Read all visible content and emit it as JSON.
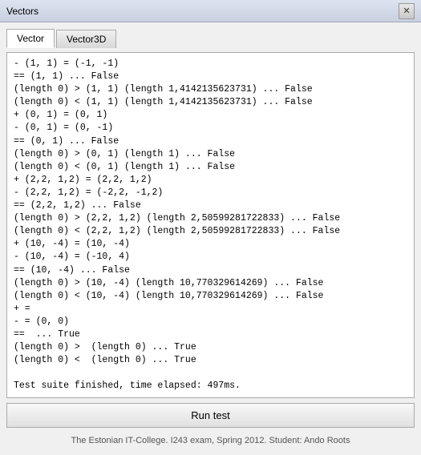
{
  "titleBar": {
    "title": "Vectors",
    "closeLabel": "✕"
  },
  "tabs": [
    {
      "id": "vector",
      "label": "Vector",
      "active": true
    },
    {
      "id": "vector3d",
      "label": "Vector3D",
      "active": false
    }
  ],
  "output": {
    "text": "- (1, 1) = (-1, -1)\n== (1, 1) ... False\n(length 0) > (1, 1) (length 1,4142135623731) ... False\n(length 0) < (1, 1) (length 1,4142135623731) ... False\n+ (0, 1) = (0, 1)\n- (0, 1) = (0, -1)\n== (0, 1) ... False\n(length 0) > (0, 1) (length 1) ... False\n(length 0) < (0, 1) (length 1) ... False\n+ (2,2, 1,2) = (2,2, 1,2)\n- (2,2, 1,2) = (-2,2, -1,2)\n== (2,2, 1,2) ... False\n(length 0) > (2,2, 1,2) (length 2,50599281722833) ... False\n(length 0) < (2,2, 1,2) (length 2,50599281722833) ... False\n+ (10, -4) = (10, -4)\n- (10, -4) = (-10, 4)\n== (10, -4) ... False\n(length 0) > (10, -4) (length 10,770329614269) ... False\n(length 0) < (10, -4) (length 10,770329614269) ... False\n+ =\n- = (0, 0)\n==  ... True\n(length 0) >  (length 0) ... True\n(length 0) <  (length 0) ... True\n\nTest suite finished, time elapsed: 497ms."
  },
  "runButton": {
    "label": "Run test"
  },
  "footer": {
    "text": "The Estonian IT-College. I243 exam, Spring 2012. Student: Ando Roots"
  }
}
